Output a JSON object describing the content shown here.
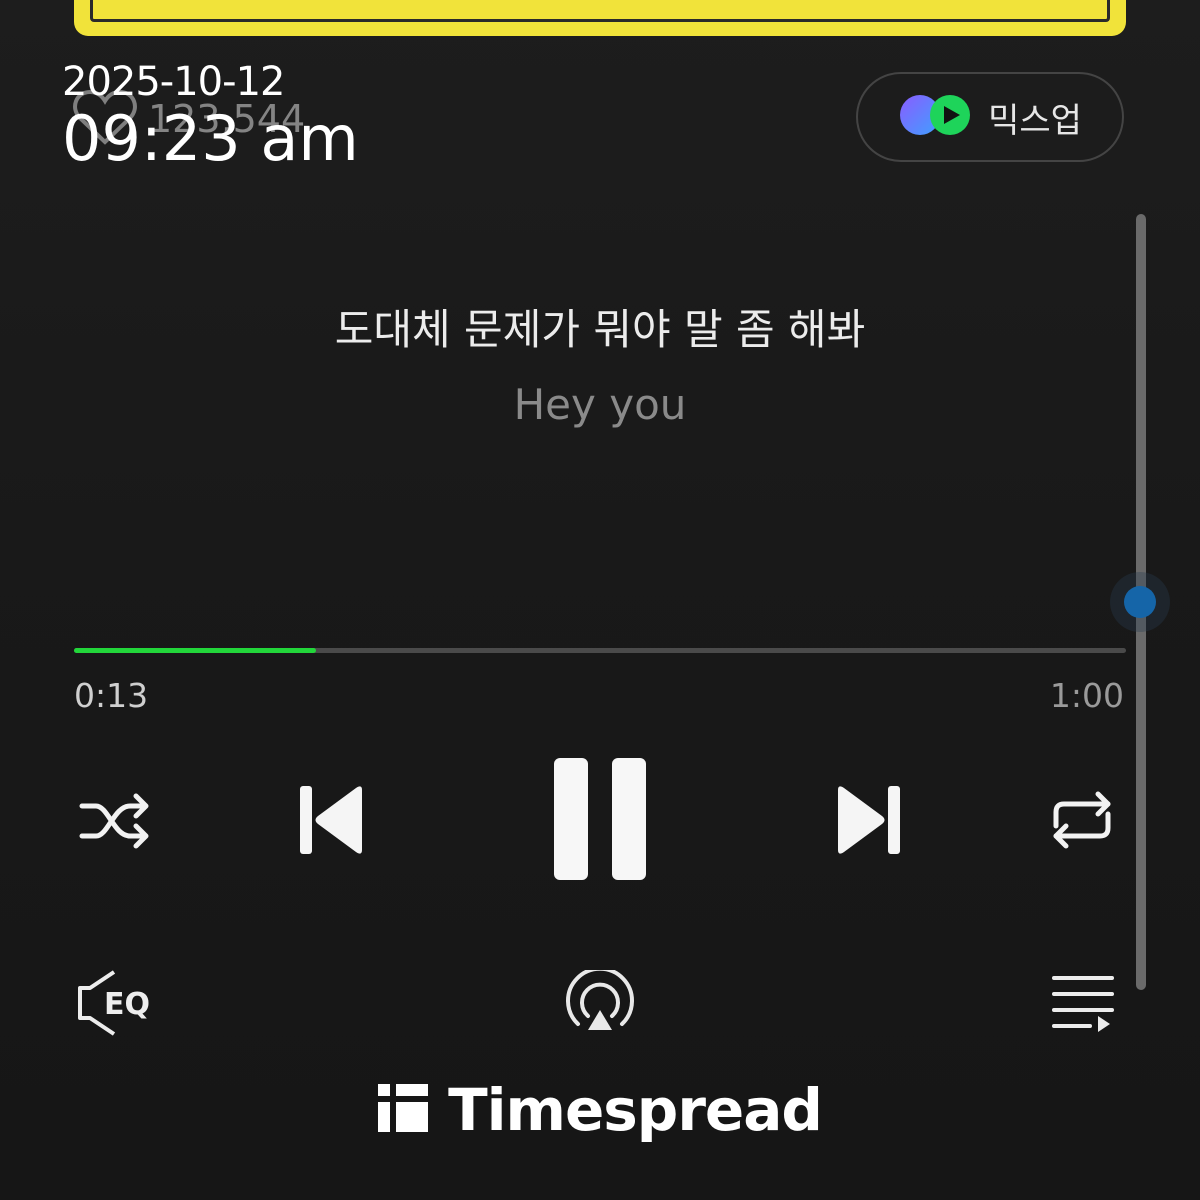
{
  "overlay": {
    "date": "2025-10-12",
    "time": "09:23 am"
  },
  "track": {
    "like_count": "123,544"
  },
  "mixup": {
    "label": "믹스업"
  },
  "lyrics": {
    "current": "도대체 문제가 뭐야 말 좀 해봐",
    "next": "Hey you"
  },
  "playback": {
    "elapsed": "0:13",
    "total": "1:00",
    "progress_fraction": 0.23,
    "state": "playing"
  },
  "controls": {
    "icons": [
      "shuffle-icon",
      "previous-icon",
      "pause-icon",
      "next-icon",
      "repeat-icon",
      "eq-icon",
      "airplay-icon",
      "playlist-icon"
    ],
    "eq_label": "EQ"
  },
  "brand": {
    "name": "Timespread"
  },
  "colors": {
    "accent_progress": "#22d63a",
    "album_art": "#f1e33a",
    "scroll_thumb": "#1565a8"
  }
}
